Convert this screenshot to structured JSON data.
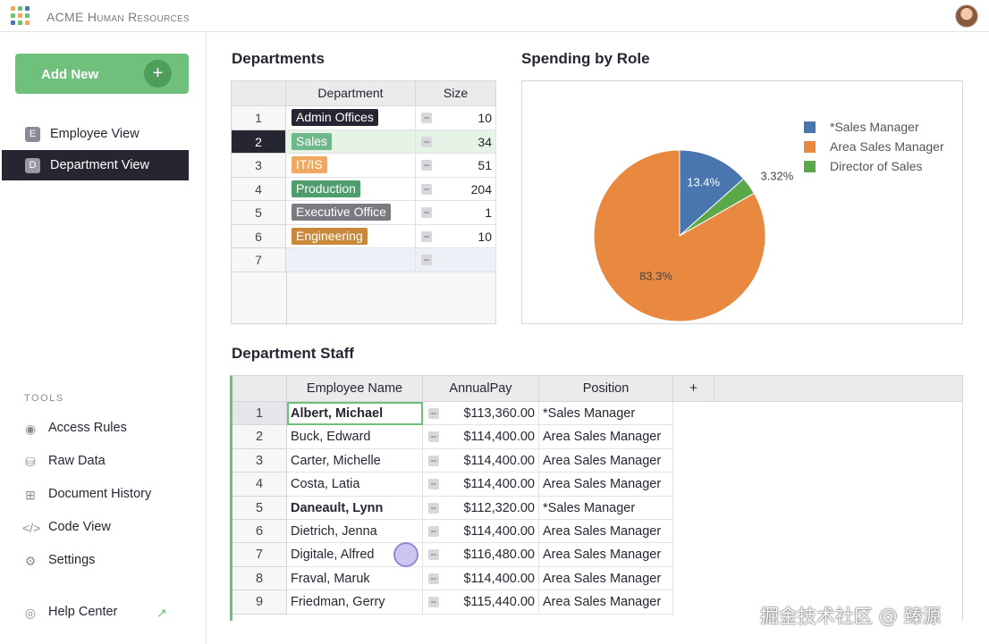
{
  "app": {
    "title": "ACME Human Resources"
  },
  "sidebar": {
    "add_new_label": "Add New",
    "views": [
      {
        "badge": "E",
        "label": "Employee View"
      },
      {
        "badge": "D",
        "label": "Department View"
      }
    ],
    "tools_header": "TOOLS",
    "tools": [
      {
        "label": "Access Rules",
        "icon": "eye-icon"
      },
      {
        "label": "Raw Data",
        "icon": "database-icon"
      },
      {
        "label": "Document History",
        "icon": "history-icon"
      },
      {
        "label": "Code View",
        "icon": "code-icon"
      },
      {
        "label": "Settings",
        "icon": "gear-icon"
      }
    ],
    "help_label": "Help Center"
  },
  "departments": {
    "title": "Departments",
    "columns": [
      "Department",
      "Size"
    ],
    "rows": [
      {
        "n": "1",
        "name": "Admin Offices",
        "size": "10",
        "color": "#262633"
      },
      {
        "n": "2",
        "name": "Sales",
        "size": "34",
        "color": "#6fb88a"
      },
      {
        "n": "3",
        "name": "IT/IS",
        "size": "51",
        "color": "#f0a860"
      },
      {
        "n": "4",
        "name": "Production",
        "size": "204",
        "color": "#4f9d6a"
      },
      {
        "n": "5",
        "name": "Executive Office",
        "size": "1",
        "color": "#7a7a80"
      },
      {
        "n": "6",
        "name": "Engineering",
        "size": "10",
        "color": "#c9883a"
      },
      {
        "n": "7",
        "name": "",
        "size": "",
        "color": ""
      }
    ]
  },
  "spending": {
    "title": "Spending by Role"
  },
  "chart_data": {
    "type": "pie",
    "title": "Spending by Role",
    "slices": [
      {
        "label": "*Sales Manager",
        "value": 13.4,
        "display": "13.4%",
        "color": "#4a76b0"
      },
      {
        "label": "Director of Sales",
        "value": 3.32,
        "display": "3.32%",
        "color": "#5aa84a"
      },
      {
        "label": "Area Sales Manager",
        "value": 83.3,
        "display": "83.3%",
        "color": "#e8893f"
      }
    ],
    "legend": [
      "*Sales Manager",
      "Area Sales Manager",
      "Director of Sales"
    ],
    "legend_position": "right"
  },
  "staff": {
    "title": "Department Staff",
    "columns": [
      "Employee Name",
      "AnnualPay",
      "Position",
      "+"
    ],
    "rows": [
      {
        "n": "1",
        "name": "Albert, Michael",
        "bold": true,
        "pay": "$113,360.00",
        "position": "*Sales Manager"
      },
      {
        "n": "2",
        "name": "Buck, Edward",
        "bold": false,
        "pay": "$114,400.00",
        "position": "Area Sales Manager"
      },
      {
        "n": "3",
        "name": "Carter, Michelle",
        "bold": false,
        "pay": "$114,400.00",
        "position": "Area Sales Manager"
      },
      {
        "n": "4",
        "name": "Costa, Latia",
        "bold": false,
        "pay": "$114,400.00",
        "position": "Area Sales Manager"
      },
      {
        "n": "5",
        "name": "Daneault, Lynn",
        "bold": true,
        "pay": "$112,320.00",
        "position": "*Sales Manager"
      },
      {
        "n": "6",
        "name": "Dietrich, Jenna",
        "bold": false,
        "pay": "$114,400.00",
        "position": "Area Sales Manager"
      },
      {
        "n": "7",
        "name": "Digitale, Alfred",
        "bold": false,
        "pay": "$116,480.00",
        "position": "Area Sales Manager"
      },
      {
        "n": "8",
        "name": "Fraval, Maruk",
        "bold": false,
        "pay": "$114,400.00",
        "position": "Area Sales Manager"
      },
      {
        "n": "9",
        "name": "Friedman, Gerry",
        "bold": false,
        "pay": "$115,440.00",
        "position": "Area Sales Manager"
      }
    ]
  },
  "watermark": "掘金技术社区 @ 臻源"
}
